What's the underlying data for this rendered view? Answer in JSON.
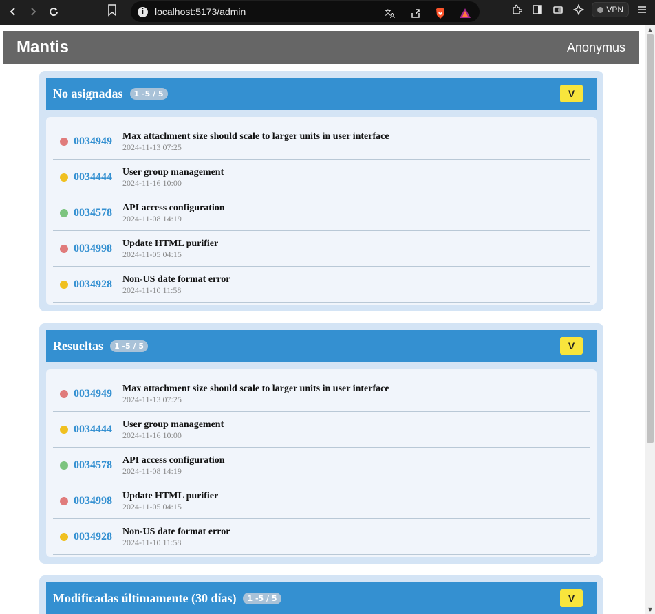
{
  "browser": {
    "url": "localhost:5173/admin",
    "vpn_label": "VPN"
  },
  "app": {
    "title": "Mantis",
    "user": "Anonymus"
  },
  "colors": {
    "red": "#e07b7b",
    "yellow": "#f0c020",
    "green": "#7cc47f",
    "header_blue": "#3490d1",
    "v_button": "#f8e53c"
  },
  "panels": [
    {
      "title": "No asignadas",
      "badge": "1 -5 / 5",
      "button": "V",
      "tickets": [
        {
          "id": "0034949",
          "title": "Max attachment size should scale to larger units in user interface",
          "date": "2024-11-13 07:25",
          "status": "red"
        },
        {
          "id": "0034444",
          "title": "User group management",
          "date": "2024-11-16 10:00",
          "status": "yellow"
        },
        {
          "id": "0034578",
          "title": "API access configuration",
          "date": "2024-11-08 14:19",
          "status": "green"
        },
        {
          "id": "0034998",
          "title": "Update HTML purifier",
          "date": "2024-11-05 04:15",
          "status": "red"
        },
        {
          "id": "0034928",
          "title": "Non-US date format error",
          "date": "2024-11-10 11:58",
          "status": "yellow"
        }
      ]
    },
    {
      "title": "Resueltas",
      "badge": "1 -5 / 5",
      "button": "V",
      "tickets": [
        {
          "id": "0034949",
          "title": "Max attachment size should scale to larger units in user interface",
          "date": "2024-11-13 07:25",
          "status": "red"
        },
        {
          "id": "0034444",
          "title": "User group management",
          "date": "2024-11-16 10:00",
          "status": "yellow"
        },
        {
          "id": "0034578",
          "title": "API access configuration",
          "date": "2024-11-08 14:19",
          "status": "green"
        },
        {
          "id": "0034998",
          "title": "Update HTML purifier",
          "date": "2024-11-05 04:15",
          "status": "red"
        },
        {
          "id": "0034928",
          "title": "Non-US date format error",
          "date": "2024-11-10 11:58",
          "status": "yellow"
        }
      ]
    },
    {
      "title": "Modificadas últimamente (30 días)",
      "badge": "1 -5 / 5",
      "button": "V"
    }
  ]
}
